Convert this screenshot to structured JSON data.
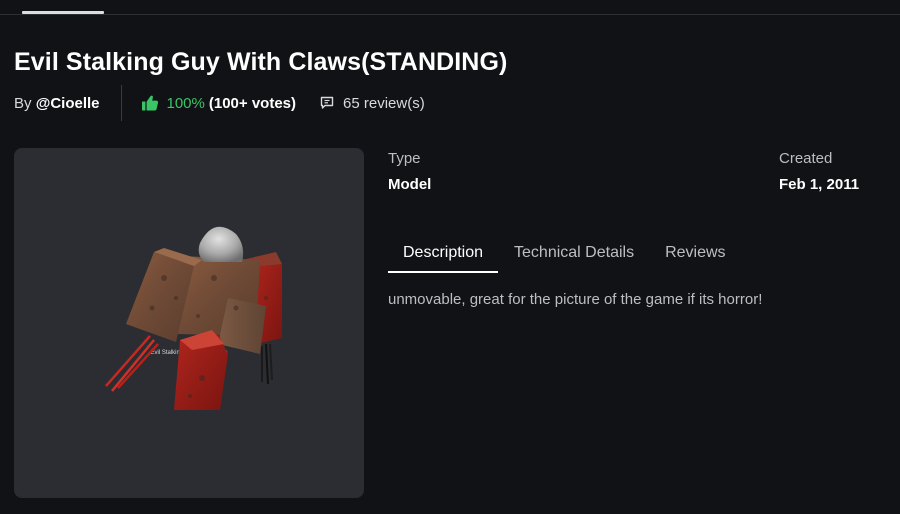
{
  "item": {
    "title": "Evil Stalking Guy With Claws(STANDING)",
    "by_prefix": "By",
    "creator": "@Cioelle",
    "rating_percent": "100%",
    "rating_votes": "(100+ votes)",
    "reviews_count": "65 review(s)",
    "thumbnail_caption": "Evil Stalking Guy With Claws"
  },
  "details": {
    "type_label": "Type",
    "type_value": "Model",
    "created_label": "Created",
    "created_value": "Feb 1, 2011"
  },
  "tabs": [
    {
      "label": "Description",
      "active": true
    },
    {
      "label": "Technical Details",
      "active": false
    },
    {
      "label": "Reviews",
      "active": false
    }
  ],
  "description_text": "unmovable, great for the picture of the game if its horror!",
  "colors": {
    "background": "#111216",
    "thumbnail_bg": "#2b2d32",
    "rating_green": "#39c566",
    "text_muted": "#bdbec2"
  },
  "icons": {
    "rating": "thumbs-up-icon",
    "reviews": "comment-icon"
  }
}
